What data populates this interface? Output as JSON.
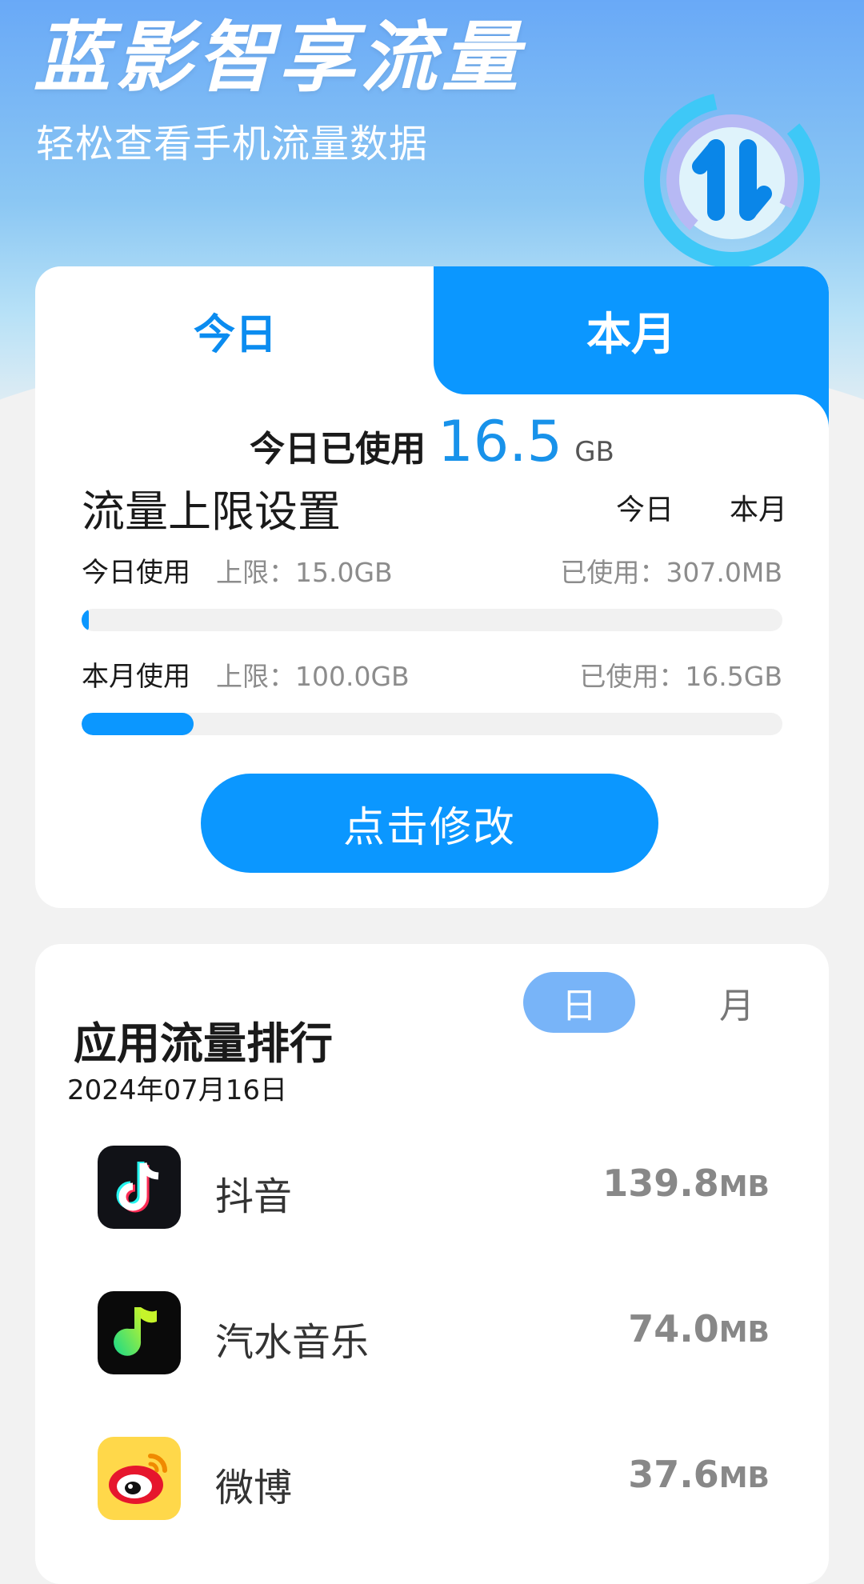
{
  "header": {
    "title": "蓝影智享流量",
    "subtitle": "轻松查看手机流量数据",
    "icon": "data-transfer-arrows-icon"
  },
  "usage_card": {
    "tabs": [
      "今日",
      "本月"
    ],
    "summary": {
      "label": "今日已使用",
      "value": "16.5",
      "unit": "GB"
    },
    "limits": {
      "title": "流量上限设置",
      "toggle": [
        "今日",
        "本月"
      ],
      "rows": [
        {
          "label": "今日使用",
          "limit": "上限：15.0GB",
          "used": "已使用：307.0MB",
          "progress": 0.01
        },
        {
          "label": "本月使用",
          "limit": "上限：100.0GB",
          "used": "已使用：16.5GB",
          "progress": 0.16
        }
      ]
    },
    "modify_button": "点击修改"
  },
  "rank_card": {
    "title": "应用流量排行",
    "segments": [
      "日",
      "月"
    ],
    "date": "2024年07月16日",
    "apps": [
      {
        "name": "抖音",
        "size": "139.8",
        "unit": "MB",
        "icon": "douyin-icon"
      },
      {
        "name": "汽水音乐",
        "size": "74.0",
        "unit": "MB",
        "icon": "qishui-music-icon"
      },
      {
        "name": "微博",
        "size": "37.6",
        "unit": "MB",
        "icon": "weibo-icon"
      }
    ]
  },
  "colors": {
    "primary": "#0b97ff",
    "accent_light": "#78b4f8",
    "header_gradient_top": "#69a9f7",
    "text_dark": "#1a1a1a",
    "text_muted": "#8c8c8c"
  }
}
